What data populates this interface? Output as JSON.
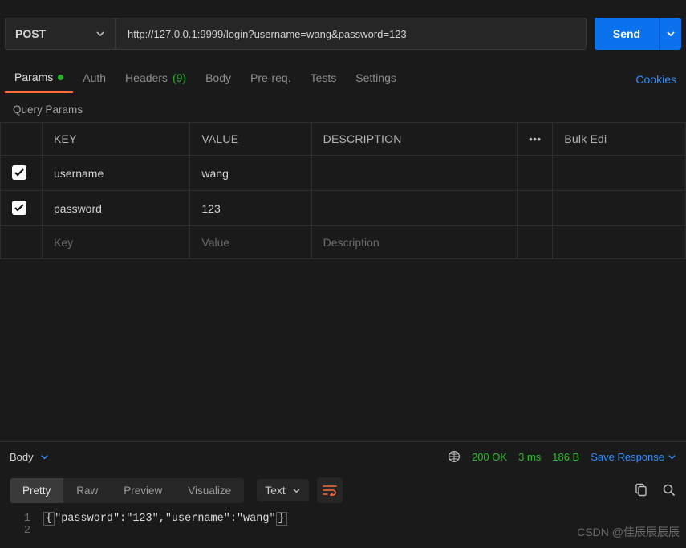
{
  "method": "POST",
  "url": "http://127.0.0.1:9999/login?username=wang&password=123",
  "sendLabel": "Send",
  "reqTabs": {
    "params": "Params",
    "auth": "Auth",
    "headers": "Headers",
    "headersCount": "(9)",
    "body": "Body",
    "prereq": "Pre-req.",
    "tests": "Tests",
    "settings": "Settings"
  },
  "cookies": "Cookies",
  "queryParamsTitle": "Query Params",
  "headers": {
    "key": "KEY",
    "value": "VALUE",
    "description": "DESCRIPTION",
    "bulk": "Bulk Edi"
  },
  "rows": [
    {
      "checked": true,
      "key": "username",
      "value": "wang"
    },
    {
      "checked": true,
      "key": "password",
      "value": "123"
    }
  ],
  "placeholders": {
    "key": "Key",
    "value": "Value",
    "description": "Description"
  },
  "response": {
    "bodyLabel": "Body",
    "status": "200 OK",
    "time": "3 ms",
    "size": "186 B",
    "save": "Save Response"
  },
  "viewTabs": {
    "pretty": "Pretty",
    "raw": "Raw",
    "preview": "Preview",
    "visualize": "Visualize"
  },
  "formatLabel": "Text",
  "codeLines": [
    {
      "n": "1",
      "text": "{\"password\":\"123\",\"username\":\"wang\"}"
    },
    {
      "n": "2",
      "text": ""
    }
  ],
  "watermark": "CSDN @佳辰辰辰辰"
}
